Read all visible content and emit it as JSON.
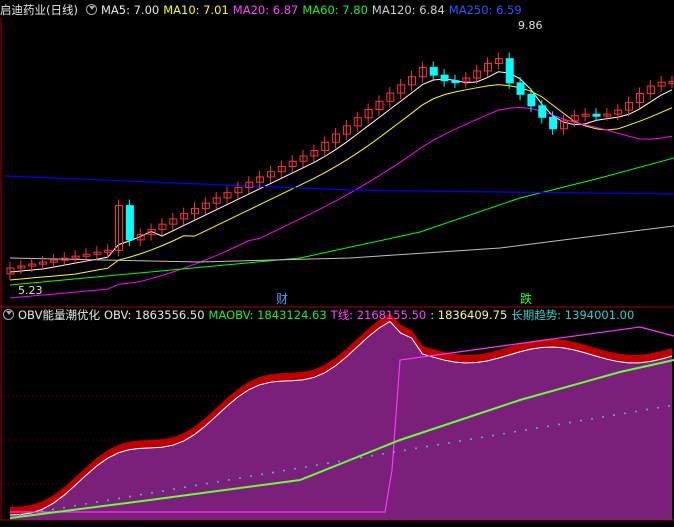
{
  "top_header": {
    "title": "启迪药业(日线)",
    "ma5_label": "MA5: 7.00",
    "ma10_label": "MA10: 7.01",
    "ma20_label": "MA20: 6.87",
    "ma60_label": "MA60: 7.80",
    "ma120_label": "MA120: 6.84",
    "ma250_label": "MA250: 6.59"
  },
  "obv_header": {
    "title": "OBV能量潮优化",
    "obv_label": "OBV: 1863556.50",
    "maobv_label": "MAOBV: 1843124.63",
    "t_label": "T线: 2168155.50",
    "t2_label": ": 1836409.75",
    "trend_label": "长期趋势: 1394001.00"
  },
  "markers": {
    "cai": "财",
    "die": "跌"
  },
  "price_labels": {
    "high": "9.86",
    "low": "5.23"
  },
  "colors": {
    "background": "#000000",
    "up": "#ff3232",
    "down": "#00ffff",
    "ma5": "#ffffff",
    "ma10": "#ffff00",
    "ma20": "#ff00ff",
    "ma60": "#00ff00",
    "ma120": "#c0c0c0",
    "ma250": "#0000ff",
    "obv_fill": "#7a1f7a",
    "obv_up_fill": "#e00000",
    "trend_line": "#66ff33",
    "t_line": "#ff33ff",
    "dots": "#33cccc"
  }
}
